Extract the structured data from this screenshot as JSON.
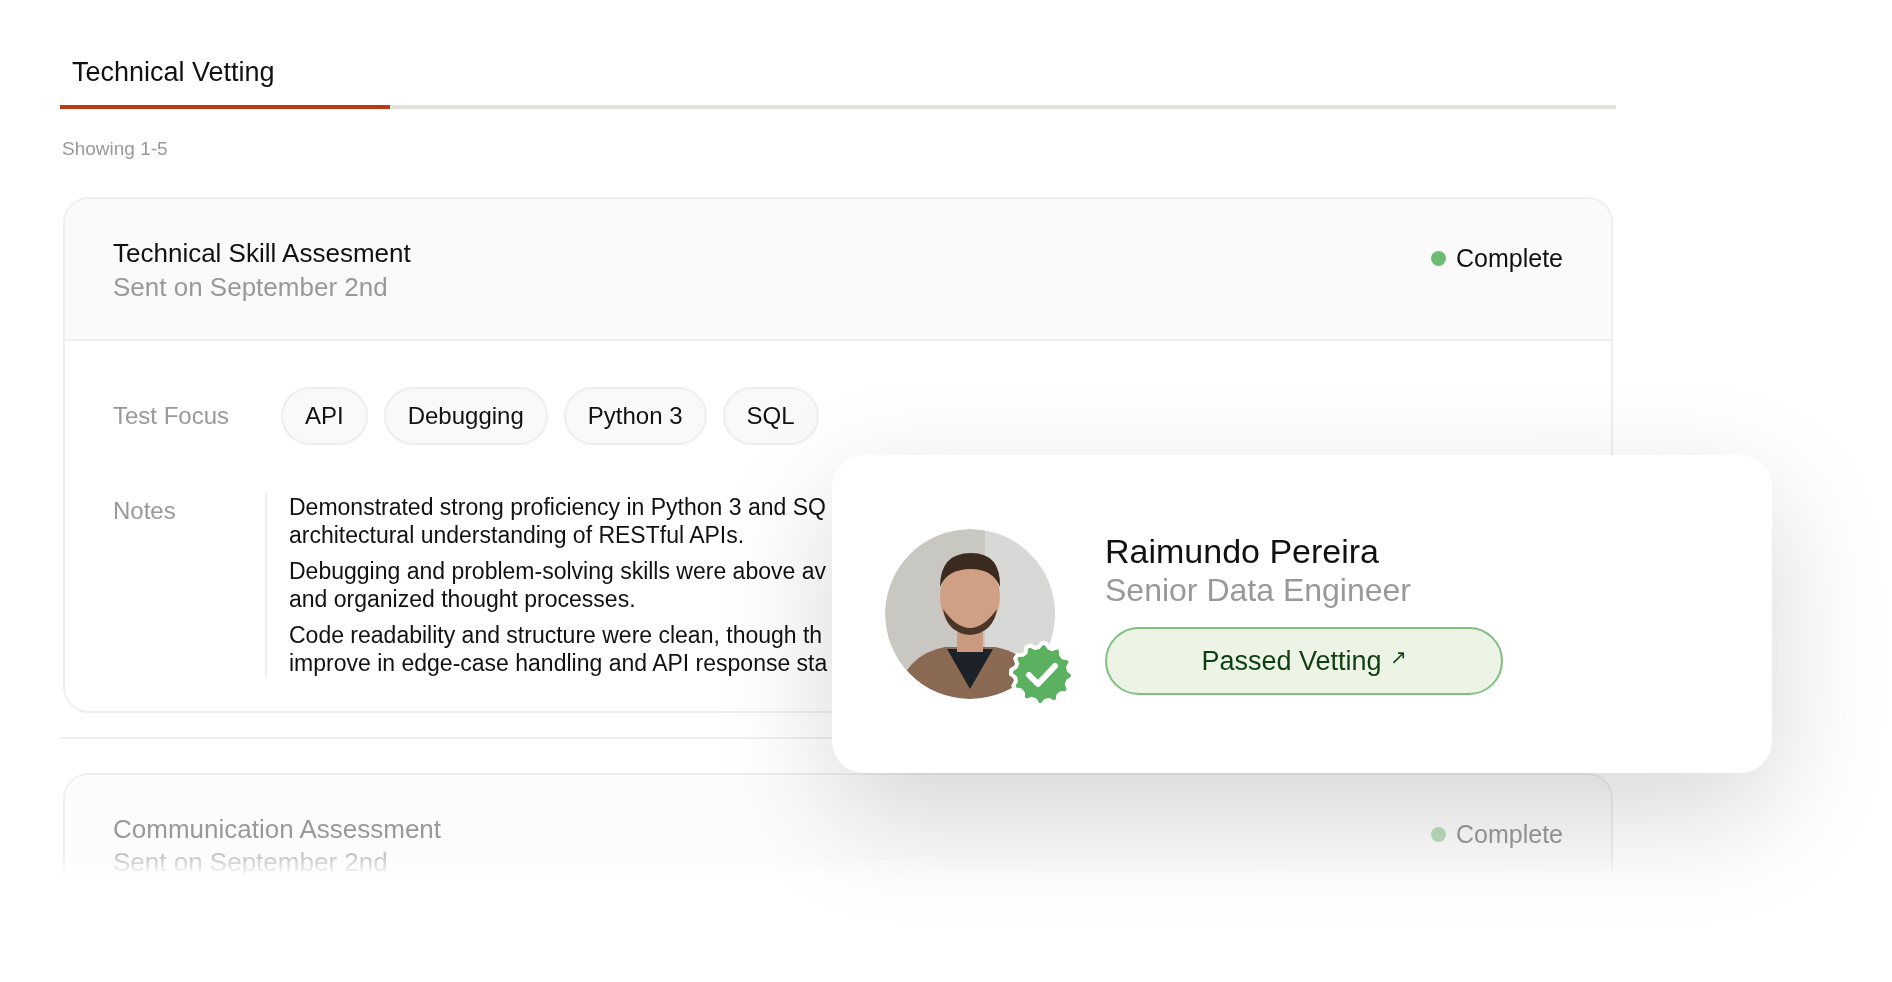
{
  "tabs": [
    {
      "label": "Technical Vetting",
      "selected": true
    }
  ],
  "showing": "Showing 1-5",
  "assessments": [
    {
      "title": "Technical Skill Assesment",
      "sent": "Sent on September 2nd",
      "status": "Complete",
      "color": "#6dbb72",
      "faded": false,
      "focus_label": "Test Focus",
      "focus": [
        "API",
        "Debugging",
        "Python 3",
        "SQL"
      ],
      "notes_label": "Notes",
      "notes": [
        [
          "Demonstrated strong proficiency in Python 3 and SQ",
          "architectural understanding of RESTful APIs."
        ],
        [
          "Debugging and problem-solving skills were above av",
          "and organized thought processes."
        ],
        [
          "Code readability and structure were clean, though th",
          "improve in edge-case handling and API response sta"
        ]
      ]
    },
    {
      "title": "Communication Assessment",
      "sent": "Sent on September 2nd",
      "status": "Complete",
      "color": "#bcdcbc",
      "faded": true
    }
  ],
  "candidate": {
    "name": "Raimundo Pereira",
    "role": "Senior Data Engineer",
    "verified": true,
    "button": "Passed Vetting",
    "button_icon": "↗"
  }
}
